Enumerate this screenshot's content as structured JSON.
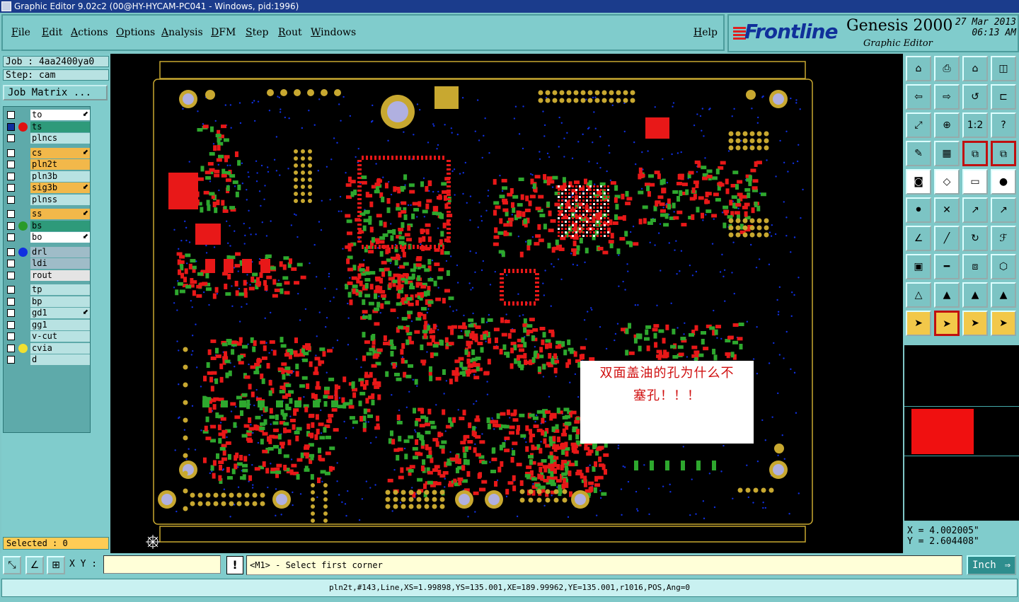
{
  "window": {
    "title": "Graphic Editor 9.02c2 (00@HY-HYCAM-PC041 - Windows, pid:1996)"
  },
  "menu": {
    "items": [
      "File",
      "Edit",
      "Actions",
      "Options",
      "Analysis",
      "DFM",
      "Step",
      "Rout",
      "Windows"
    ],
    "help": "Help"
  },
  "logo": {
    "brand": "Frontline",
    "product": "Genesis 2000",
    "subtitle": "Graphic Editor",
    "date": "27 Mar 2013",
    "time": "06:13 AM"
  },
  "job": {
    "job_label": "Job : 4aa2400ya0",
    "step_label": "Step: cam",
    "matrix_button": "Job Matrix ..."
  },
  "layers": [
    {
      "name": "to",
      "bg": "#ffffff",
      "dot": "",
      "arrow": true
    },
    {
      "name": "ts",
      "bg": "#2e9a7a",
      "dot": "#e01010",
      "arrow": false,
      "active": true
    },
    {
      "name": "plncs",
      "bg": "#b8e2e2",
      "dot": "",
      "arrow": false
    },
    {
      "name": "cs",
      "bg": "#f2b84a",
      "dot": "",
      "arrow": true
    },
    {
      "name": "pln2t",
      "bg": "#f2b84a",
      "dot": "",
      "arrow": false
    },
    {
      "name": "pln3b",
      "bg": "#b8e2e2",
      "dot": "",
      "arrow": false
    },
    {
      "name": "sig3b",
      "bg": "#f2b84a",
      "dot": "",
      "arrow": true
    },
    {
      "name": "plnss",
      "bg": "#b8e2e2",
      "dot": "",
      "arrow": false
    },
    {
      "name": "ss",
      "bg": "#f2b84a",
      "dot": "",
      "arrow": true
    },
    {
      "name": "bs",
      "bg": "#2e9a7a",
      "dot": "#2a9a2a",
      "arrow": false
    },
    {
      "name": "bo",
      "bg": "#ffffff",
      "dot": "",
      "arrow": true
    },
    {
      "name": "drl",
      "bg": "#9fbcc8",
      "dot": "#1030e0",
      "arrow": false
    },
    {
      "name": "ldi",
      "bg": "#9fbcc8",
      "dot": "",
      "arrow": false
    },
    {
      "name": "rout",
      "bg": "#e4e4e4",
      "dot": "",
      "arrow": false
    },
    {
      "name": "tp",
      "bg": "#b8e2e2",
      "dot": "",
      "arrow": false
    },
    {
      "name": "bp",
      "bg": "#b8e2e2",
      "dot": "",
      "arrow": false
    },
    {
      "name": "gd1",
      "bg": "#b8e2e2",
      "dot": "",
      "arrow": true
    },
    {
      "name": "gg1",
      "bg": "#b8e2e2",
      "dot": "",
      "arrow": false
    },
    {
      "name": "v-cut",
      "bg": "#b8e2e2",
      "dot": "",
      "arrow": false
    },
    {
      "name": "cvia",
      "bg": "#b8e2e2",
      "dot": "#f0e030",
      "arrow": false
    },
    {
      "name": "d",
      "bg": "#b8e2e2",
      "dot": "",
      "arrow": false
    }
  ],
  "selected": "Selected : 0",
  "annotation": {
    "line1": "双面盖油的孔为什么不",
    "line2": "塞孔！！！"
  },
  "tools": {
    "row_labels": [
      [
        "home-up-icon",
        "save-icon",
        "home-icon",
        "window-split-icon"
      ],
      [
        "import-icon",
        "export-icon",
        "flip-icon",
        "step-repeat-icon"
      ],
      [
        "zoom-fit-icon",
        "zoom-center-icon",
        "scale-1-2-icon",
        "help-query-icon"
      ],
      [
        "measure-icon",
        "grid-icon",
        "layer-compare-icon",
        "layer-compare-2-icon"
      ],
      [
        "pad-icon",
        "polygon-icon",
        "ruler-icon",
        "round-pad-icon"
      ],
      [
        "connect-icon",
        "cross-icon",
        "line-add-icon",
        "line-edit-icon"
      ],
      [
        "angle-icon",
        "diagonal-icon",
        "arc-icon",
        "text-icon"
      ],
      [
        "move-icon",
        "line-icon",
        "measure-distance-icon",
        "pad-group-icon"
      ],
      [
        "triangle-icon",
        "triangle-outline-icon",
        "triangle-up-icon",
        "triangle-cut-icon"
      ],
      [
        "select-icon",
        "select-box-icon",
        "select-cursor-icon",
        "select-connect-icon"
      ]
    ],
    "scale_label": "1:2"
  },
  "coords": {
    "x": "X = 4.002005\"",
    "y": "Y = 2.604408\""
  },
  "bottom": {
    "xy_label": "X Y :",
    "xy_value": "",
    "prompt": "<M1> - Select first corner",
    "unit": "Inch",
    "warn": "!"
  },
  "status": "pln2t,#143,Line,XS=1.99898,YS=135.001,XE=189.99962,YE=135.001,r1016,POS,Ang=0",
  "colors": {
    "background": "#7fc8c8",
    "title_bar": "#1b3c8c",
    "canvas": "#000000",
    "pad_red": "#e81818",
    "pad_green": "#2ea82e",
    "pad_gold": "#c8a830"
  }
}
